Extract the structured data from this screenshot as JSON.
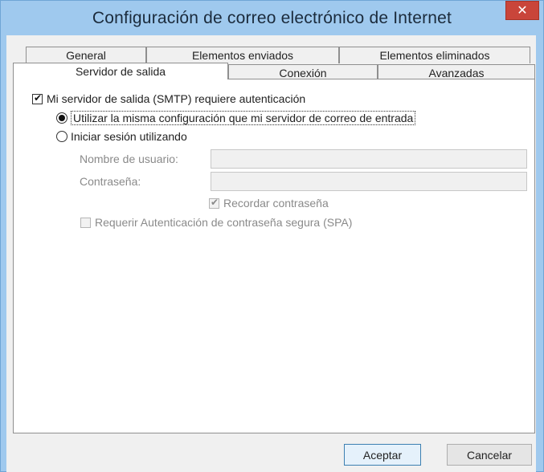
{
  "window": {
    "title": "Configuración de correo electrónico de Internet",
    "close_glyph": "✕"
  },
  "tabs": {
    "row1": [
      {
        "label": "General"
      },
      {
        "label": "Elementos enviados"
      },
      {
        "label": "Elementos eliminados"
      }
    ],
    "row2": [
      {
        "label": "Servidor de salida",
        "selected": true
      },
      {
        "label": "Conexión"
      },
      {
        "label": "Avanzadas"
      }
    ]
  },
  "outgoing": {
    "requires_auth": {
      "label": "Mi servidor de salida (SMTP) requiere autenticación",
      "checked": true
    },
    "radio_same": {
      "label": "Utilizar la misma configuración que mi servidor de correo de entrada",
      "selected": true
    },
    "radio_login": {
      "label": "Iniciar sesión utilizando",
      "selected": false
    },
    "username": {
      "label": "Nombre de usuario:",
      "value": ""
    },
    "password": {
      "label": "Contraseña:",
      "value": ""
    },
    "remember_password": {
      "label": "Recordar contraseña",
      "checked": true
    },
    "spa": {
      "label": "Requerir Autenticación de contraseña segura (SPA)",
      "checked": false
    }
  },
  "buttons": {
    "ok": "Aceptar",
    "cancel": "Cancelar"
  },
  "icons": {
    "check": "✔"
  }
}
